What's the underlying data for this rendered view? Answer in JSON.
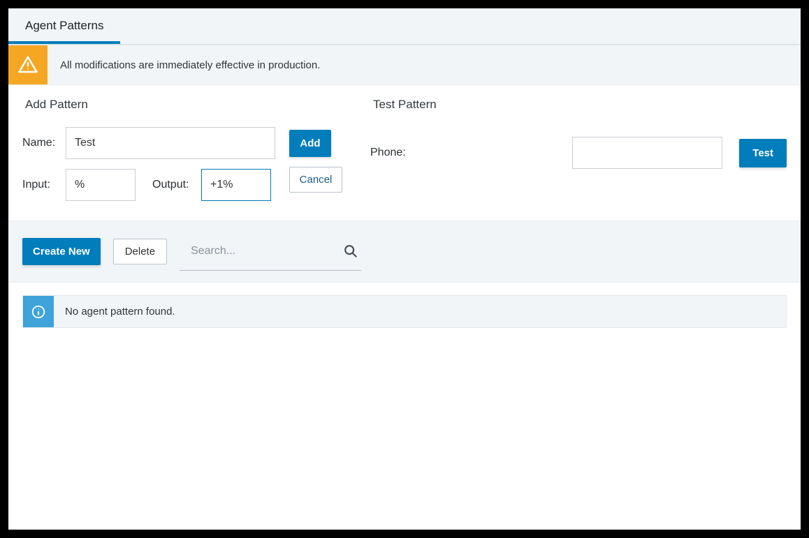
{
  "tabs": {
    "agent_patterns": "Agent Patterns"
  },
  "warning": {
    "message": "All modifications are immediately effective in production."
  },
  "add_pattern": {
    "title": "Add Pattern",
    "name_label": "Name:",
    "name_value": "Test",
    "input_label": "Input:",
    "input_value": "%",
    "output_label": "Output:",
    "output_value": "+1%",
    "add_button": "Add",
    "cancel_button": "Cancel"
  },
  "test_pattern": {
    "title": "Test Pattern",
    "phone_label": "Phone:",
    "phone_value": "",
    "test_button": "Test"
  },
  "toolbar": {
    "create_new": "Create New",
    "delete": "Delete",
    "search_placeholder": "Search..."
  },
  "list": {
    "empty_message": "No agent pattern found."
  }
}
